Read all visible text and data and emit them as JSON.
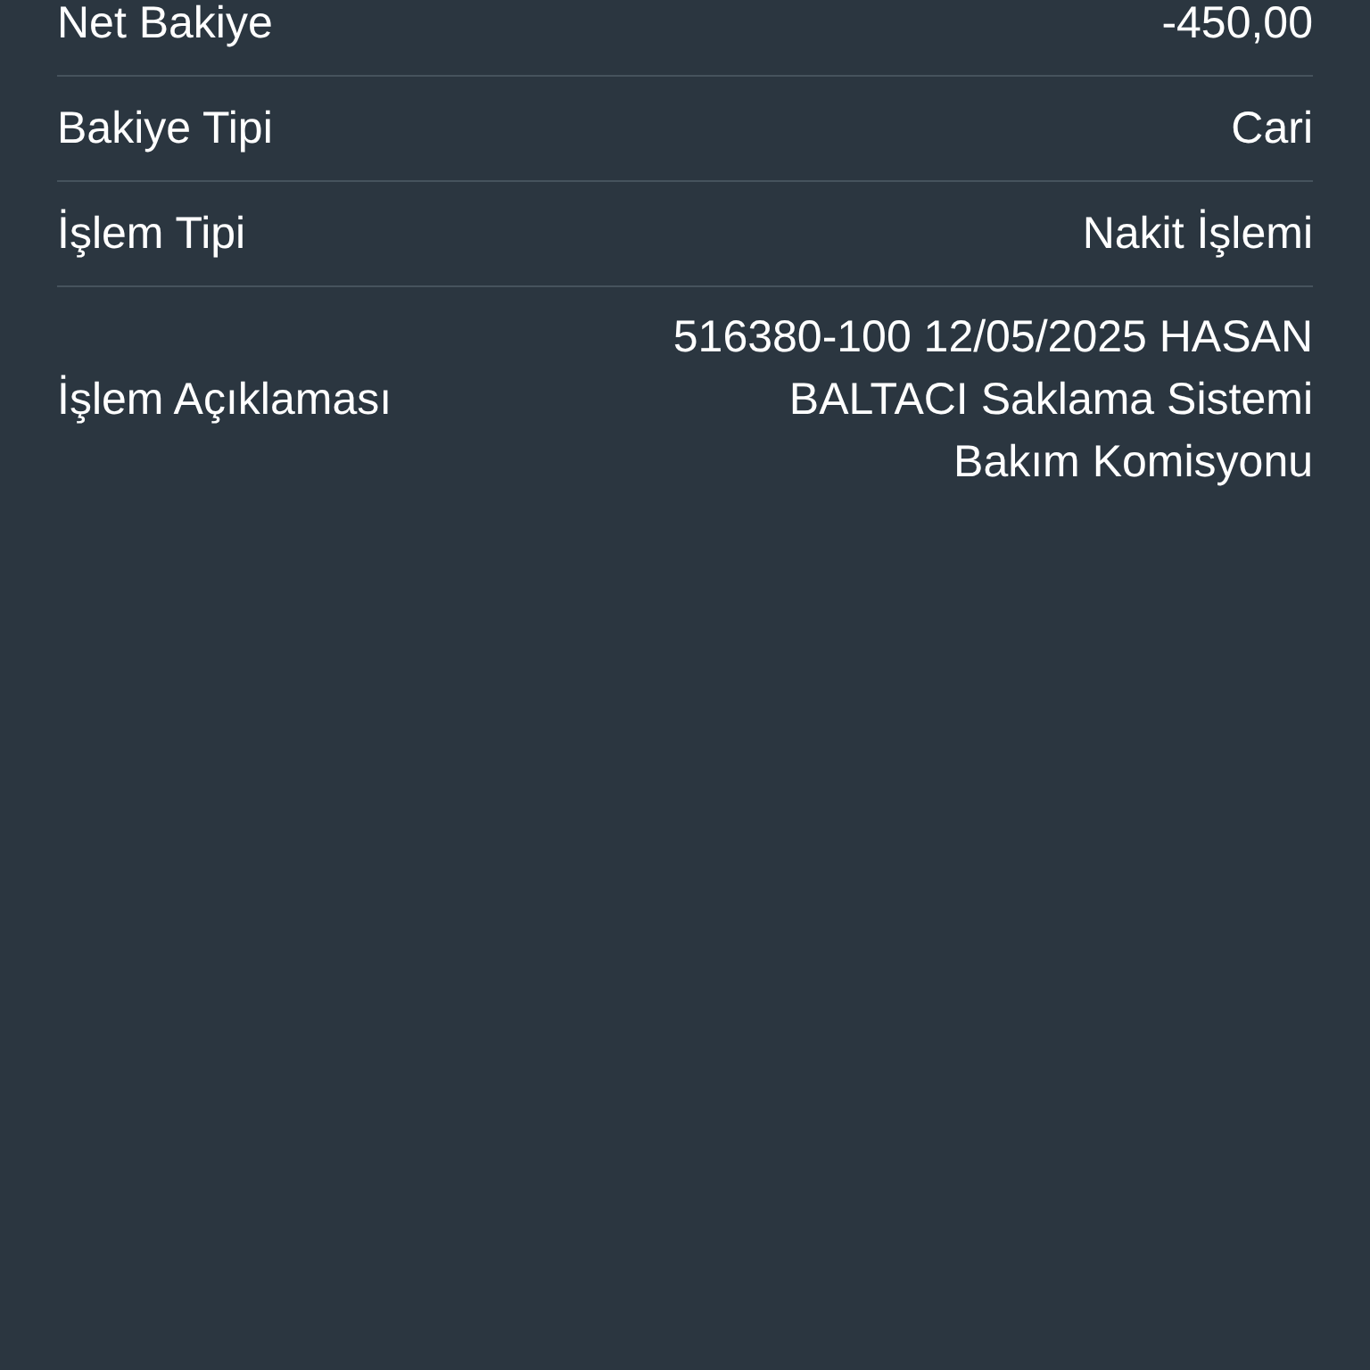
{
  "rows": [
    {
      "label": "Net Bakiye",
      "value": "-450,00"
    },
    {
      "label": "Bakiye Tipi",
      "value": "Cari"
    },
    {
      "label": "İşlem Tipi",
      "value": "Nakit İşlemi"
    },
    {
      "label": "İşlem Açıklaması",
      "value": "516380-100 12/05/2025 HASAN BALTACI Saklama Sistemi Bakım Komisyonu"
    }
  ]
}
